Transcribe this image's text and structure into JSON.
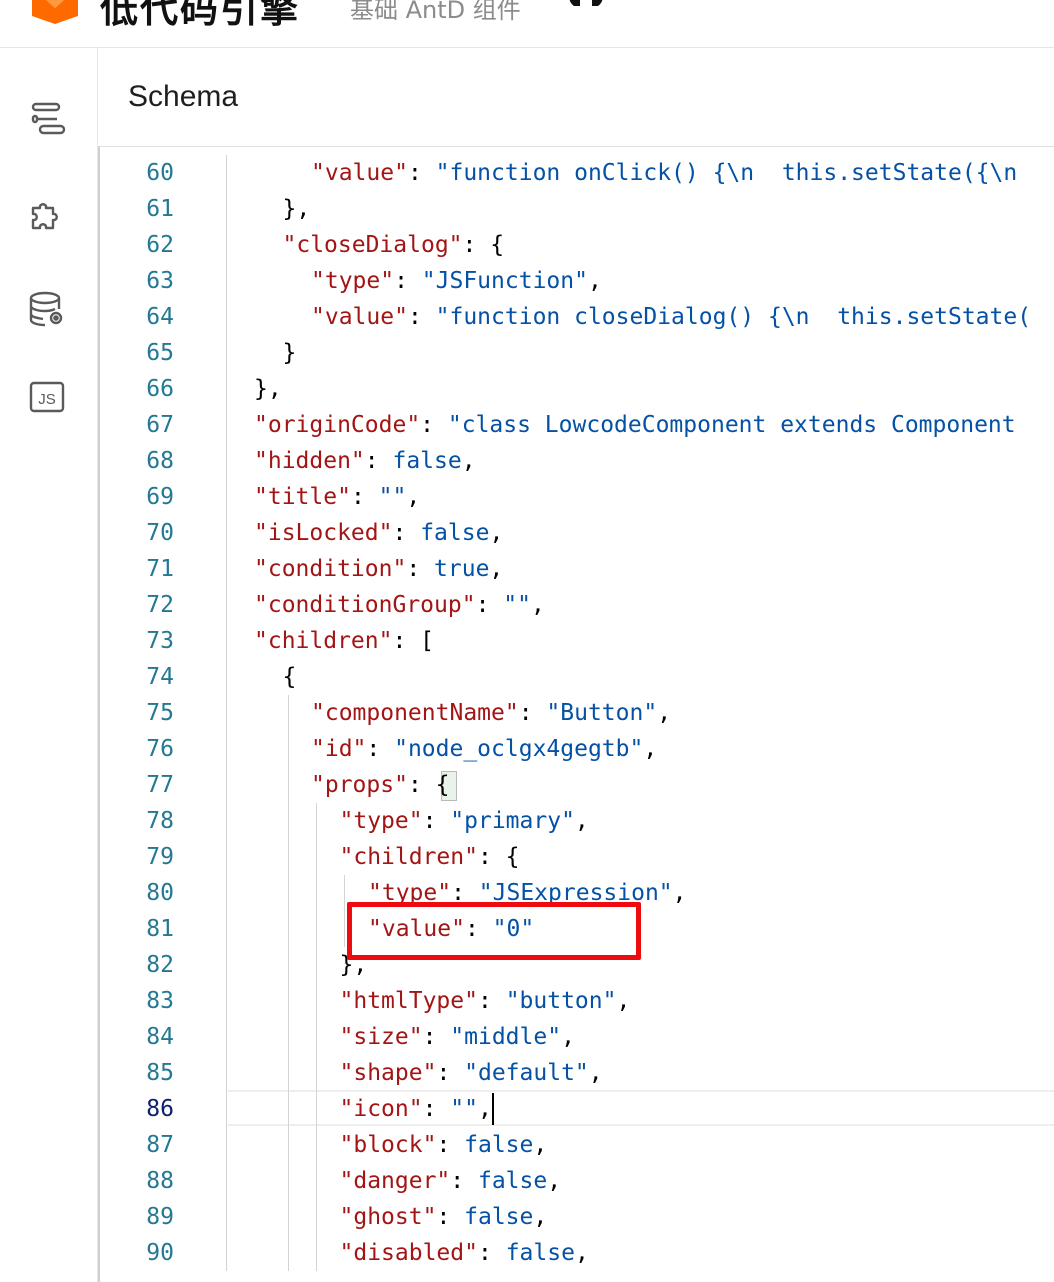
{
  "header": {
    "brand": "低代码引擎",
    "subtitle": "基础 AntD 组件"
  },
  "panel": {
    "title": "Schema"
  },
  "sidebar": {
    "icons": [
      "outline-icon",
      "plugin-puzzle-icon",
      "datasource-icon",
      "js-code-icon"
    ],
    "js_label": "JS"
  },
  "editor": {
    "active_line": 86,
    "lines": [
      {
        "n": "60",
        "indent": 2,
        "tokens": [
          [
            "k",
            "\"value\""
          ],
          [
            "p",
            ": "
          ],
          [
            "s",
            "\"function onClick() {\\n  this.setState({\\n"
          ]
        ]
      },
      {
        "n": "61",
        "indent": 1,
        "tokens": [
          [
            "p",
            "},"
          ]
        ]
      },
      {
        "n": "62",
        "indent": 1,
        "tokens": [
          [
            "k",
            "\"closeDialog\""
          ],
          [
            "p",
            ": {"
          ]
        ]
      },
      {
        "n": "63",
        "indent": 2,
        "tokens": [
          [
            "k",
            "\"type\""
          ],
          [
            "p",
            ": "
          ],
          [
            "s",
            "\"JSFunction\""
          ],
          [
            "p",
            ","
          ]
        ]
      },
      {
        "n": "64",
        "indent": 2,
        "tokens": [
          [
            "k",
            "\"value\""
          ],
          [
            "p",
            ": "
          ],
          [
            "s",
            "\"function closeDialog() {\\n  this.setState("
          ]
        ]
      },
      {
        "n": "65",
        "indent": 1,
        "tokens": [
          [
            "p",
            "}"
          ]
        ]
      },
      {
        "n": "66",
        "indent": 0,
        "tokens": [
          [
            "p",
            "},"
          ]
        ]
      },
      {
        "n": "67",
        "indent": 0,
        "tokens": [
          [
            "k",
            "\"originCode\""
          ],
          [
            "p",
            ": "
          ],
          [
            "s",
            "\"class LowcodeComponent extends Component"
          ]
        ]
      },
      {
        "n": "68",
        "indent": 0,
        "tokens": [
          [
            "k",
            "\"hidden\""
          ],
          [
            "p",
            ": "
          ],
          [
            "v",
            "false"
          ],
          [
            "p",
            ","
          ]
        ]
      },
      {
        "n": "69",
        "indent": 0,
        "tokens": [
          [
            "k",
            "\"title\""
          ],
          [
            "p",
            ": "
          ],
          [
            "s",
            "\"\""
          ],
          [
            "p",
            ","
          ]
        ]
      },
      {
        "n": "70",
        "indent": 0,
        "tokens": [
          [
            "k",
            "\"isLocked\""
          ],
          [
            "p",
            ": "
          ],
          [
            "v",
            "false"
          ],
          [
            "p",
            ","
          ]
        ]
      },
      {
        "n": "71",
        "indent": 0,
        "tokens": [
          [
            "k",
            "\"condition\""
          ],
          [
            "p",
            ": "
          ],
          [
            "v",
            "true"
          ],
          [
            "p",
            ","
          ]
        ]
      },
      {
        "n": "72",
        "indent": 0,
        "tokens": [
          [
            "k",
            "\"conditionGroup\""
          ],
          [
            "p",
            ": "
          ],
          [
            "s",
            "\"\""
          ],
          [
            "p",
            ","
          ]
        ]
      },
      {
        "n": "73",
        "indent": 0,
        "tokens": [
          [
            "k",
            "\"children\""
          ],
          [
            "p",
            ": ["
          ]
        ]
      },
      {
        "n": "74",
        "indent": 1,
        "tokens": [
          [
            "p",
            "{"
          ]
        ]
      },
      {
        "n": "75",
        "indent": 2,
        "tokens": [
          [
            "k",
            "\"componentName\""
          ],
          [
            "p",
            ": "
          ],
          [
            "s",
            "\"Button\""
          ],
          [
            "p",
            ","
          ]
        ]
      },
      {
        "n": "76",
        "indent": 2,
        "tokens": [
          [
            "k",
            "\"id\""
          ],
          [
            "p",
            ": "
          ],
          [
            "s",
            "\"node_oclgx4gegtb\""
          ],
          [
            "p",
            ","
          ]
        ]
      },
      {
        "n": "77",
        "indent": 2,
        "tokens": [
          [
            "k",
            "\"props\""
          ],
          [
            "p",
            ": {"
          ]
        ]
      },
      {
        "n": "78",
        "indent": 3,
        "tokens": [
          [
            "k",
            "\"type\""
          ],
          [
            "p",
            ": "
          ],
          [
            "s",
            "\"primary\""
          ],
          [
            "p",
            ","
          ]
        ]
      },
      {
        "n": "79",
        "indent": 3,
        "tokens": [
          [
            "k",
            "\"children\""
          ],
          [
            "p",
            ": {"
          ]
        ]
      },
      {
        "n": "80",
        "indent": 4,
        "tokens": [
          [
            "k",
            "\"type\""
          ],
          [
            "p",
            ": "
          ],
          [
            "s",
            "\"JSExpression\""
          ],
          [
            "p",
            ","
          ]
        ]
      },
      {
        "n": "81",
        "indent": 4,
        "tokens": [
          [
            "k",
            "\"value\""
          ],
          [
            "p",
            ": "
          ],
          [
            "s",
            "\"0\""
          ]
        ]
      },
      {
        "n": "82",
        "indent": 3,
        "tokens": [
          [
            "p",
            "},"
          ]
        ]
      },
      {
        "n": "83",
        "indent": 3,
        "tokens": [
          [
            "k",
            "\"htmlType\""
          ],
          [
            "p",
            ": "
          ],
          [
            "s",
            "\"button\""
          ],
          [
            "p",
            ","
          ]
        ]
      },
      {
        "n": "84",
        "indent": 3,
        "tokens": [
          [
            "k",
            "\"size\""
          ],
          [
            "p",
            ": "
          ],
          [
            "s",
            "\"middle\""
          ],
          [
            "p",
            ","
          ]
        ]
      },
      {
        "n": "85",
        "indent": 3,
        "tokens": [
          [
            "k",
            "\"shape\""
          ],
          [
            "p",
            ": "
          ],
          [
            "s",
            "\"default\""
          ],
          [
            "p",
            ","
          ]
        ]
      },
      {
        "n": "86",
        "indent": 3,
        "tokens": [
          [
            "k",
            "\"icon\""
          ],
          [
            "p",
            ": "
          ],
          [
            "s",
            "\"\""
          ],
          [
            "p",
            ","
          ]
        ]
      },
      {
        "n": "87",
        "indent": 3,
        "tokens": [
          [
            "k",
            "\"block\""
          ],
          [
            "p",
            ": "
          ],
          [
            "v",
            "false"
          ],
          [
            "p",
            ","
          ]
        ]
      },
      {
        "n": "88",
        "indent": 3,
        "tokens": [
          [
            "k",
            "\"danger\""
          ],
          [
            "p",
            ": "
          ],
          [
            "v",
            "false"
          ],
          [
            "p",
            ","
          ]
        ]
      },
      {
        "n": "89",
        "indent": 3,
        "tokens": [
          [
            "k",
            "\"ghost\""
          ],
          [
            "p",
            ": "
          ],
          [
            "v",
            "false"
          ],
          [
            "p",
            ","
          ]
        ]
      },
      {
        "n": "90",
        "indent": 3,
        "tokens": [
          [
            "k",
            "\"disabled\""
          ],
          [
            "p",
            ": "
          ],
          [
            "v",
            "false"
          ],
          [
            "p",
            ","
          ]
        ]
      }
    ]
  }
}
